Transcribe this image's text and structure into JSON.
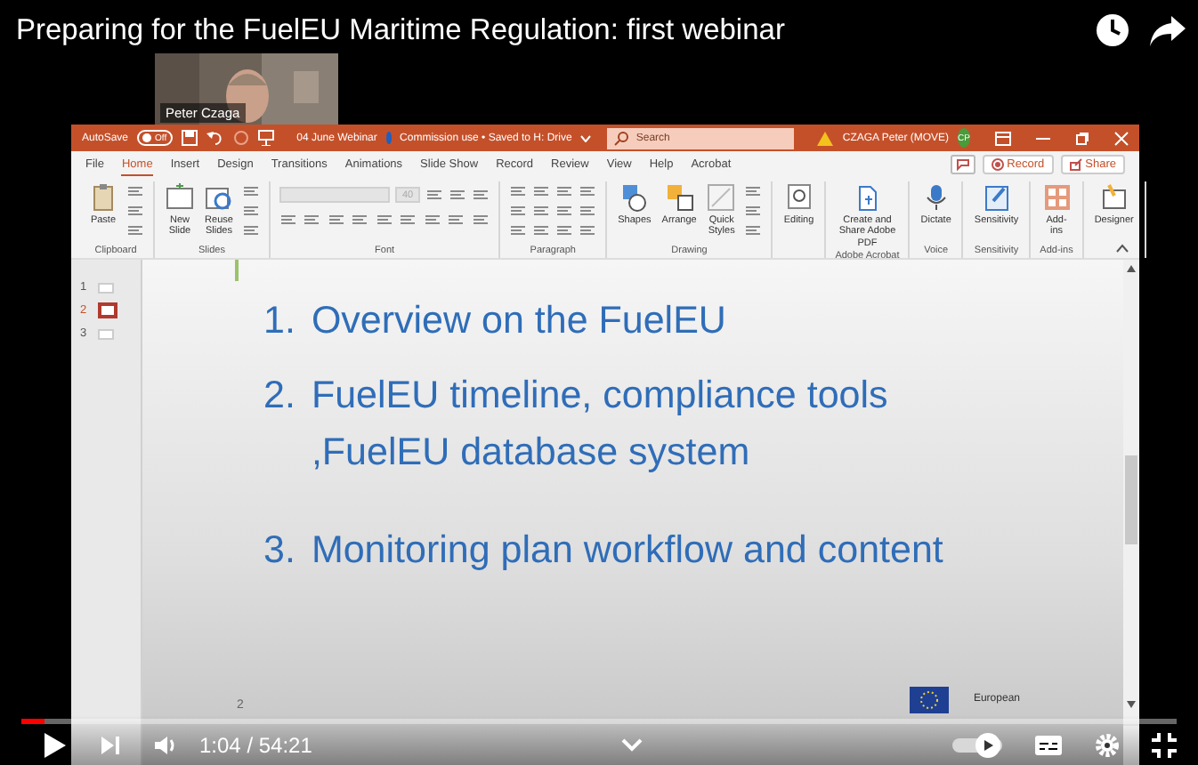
{
  "video": {
    "title": "Preparing for the FuelEU Maritime Regulation: first webinar",
    "webcam": {
      "name": "Peter Czaga"
    }
  },
  "powerpoint": {
    "autosave": {
      "label": "AutoSave",
      "on": false,
      "state": "Off"
    },
    "file_name": "04 June Webinar",
    "file_status": "Commission use • Saved to H: Drive",
    "search": {
      "placeholder": "Search"
    },
    "user": {
      "name": "CZAGA Peter (MOVE)",
      "initials": "CP"
    },
    "tabs": [
      {
        "label": "File",
        "selected": false
      },
      {
        "label": "Home",
        "selected": true
      },
      {
        "label": "Insert",
        "selected": false
      },
      {
        "label": "Design",
        "selected": false
      },
      {
        "label": "Transitions",
        "selected": false
      },
      {
        "label": "Animations",
        "selected": false
      },
      {
        "label": "Slide Show",
        "selected": false
      },
      {
        "label": "Record",
        "selected": false
      },
      {
        "label": "Review",
        "selected": false
      },
      {
        "label": "View",
        "selected": false
      },
      {
        "label": "Help",
        "selected": false
      },
      {
        "label": "Acrobat",
        "selected": false
      }
    ],
    "record_button": "Record",
    "share_button": "Share",
    "font_size": "40",
    "ribbon_groups": [
      {
        "label": "Clipboard",
        "buttons": [
          "Paste"
        ]
      },
      {
        "label": "Slides",
        "buttons": [
          "New Slide",
          "Reuse Slides"
        ]
      },
      {
        "label": "Font",
        "kind": "font"
      },
      {
        "label": "Paragraph",
        "kind": "paragraph"
      },
      {
        "label": "Drawing",
        "buttons": [
          "Shapes",
          "Arrange",
          "Quick Styles"
        ]
      },
      {
        "buttons": [
          "Editing"
        ]
      },
      {
        "label": "Adobe Acrobat",
        "buttons": [
          "Create and Share Adobe PDF"
        ]
      },
      {
        "label": "Voice",
        "buttons": [
          "Dictate"
        ]
      },
      {
        "label": "Sensitivity",
        "buttons": [
          "Sensitivity"
        ]
      },
      {
        "label": "Add-ins",
        "buttons": [
          "Add-ins"
        ]
      },
      {
        "buttons": [
          "Designer"
        ]
      }
    ],
    "thumbnails": [
      {
        "number": "1",
        "selected": false
      },
      {
        "number": "2",
        "selected": true
      },
      {
        "number": "3",
        "selected": false
      }
    ],
    "slide": {
      "items": [
        {
          "number": "1.",
          "lines": [
            "Overview on the FuelEU"
          ]
        },
        {
          "number": "2.",
          "lines": [
            "FuelEU timeline, compliance tools",
            ",FuelEU database system"
          ]
        },
        {
          "number": "3.",
          "lines": [
            "Monitoring plan workflow and content"
          ]
        }
      ],
      "page_number": "2",
      "logo_text": "European"
    }
  },
  "player": {
    "progress": {
      "level": 0.02
    },
    "time": "1:04 / 54:21",
    "autoplay": true
  }
}
